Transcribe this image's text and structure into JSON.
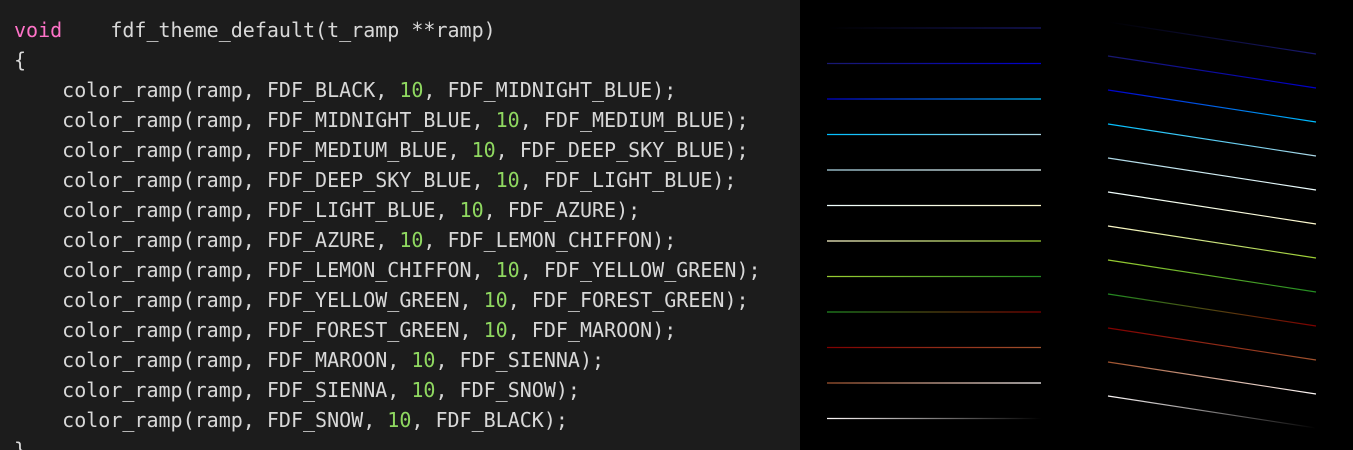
{
  "editor": {
    "signature": {
      "keyword": "void",
      "rest": "    fdf_theme_default(t_ramp **ramp)"
    },
    "open_brace": "{",
    "close_brace": "}",
    "calls": [
      {
        "prefix": "    color_ramp(ramp, FDF_BLACK, ",
        "num": "10",
        "suffix": ", FDF_MIDNIGHT_BLUE);"
      },
      {
        "prefix": "    color_ramp(ramp, FDF_MIDNIGHT_BLUE, ",
        "num": "10",
        "suffix": ", FDF_MEDIUM_BLUE);"
      },
      {
        "prefix": "    color_ramp(ramp, FDF_MEDIUM_BLUE, ",
        "num": "10",
        "suffix": ", FDF_DEEP_SKY_BLUE);"
      },
      {
        "prefix": "    color_ramp(ramp, FDF_DEEP_SKY_BLUE, ",
        "num": "10",
        "suffix": ", FDF_LIGHT_BLUE);"
      },
      {
        "prefix": "    color_ramp(ramp, FDF_LIGHT_BLUE, ",
        "num": "10",
        "suffix": ", FDF_AZURE);"
      },
      {
        "prefix": "    color_ramp(ramp, FDF_AZURE, ",
        "num": "10",
        "suffix": ", FDF_LEMON_CHIFFON);"
      },
      {
        "prefix": "    color_ramp(ramp, FDF_LEMON_CHIFFON, ",
        "num": "10",
        "suffix": ", FDF_YELLOW_GREEN);"
      },
      {
        "prefix": "    color_ramp(ramp, FDF_YELLOW_GREEN, ",
        "num": "10",
        "suffix": ", FDF_FOREST_GREEN);"
      },
      {
        "prefix": "    color_ramp(ramp, FDF_FOREST_GREEN, ",
        "num": "10",
        "suffix": ", FDF_MAROON);"
      },
      {
        "prefix": "    color_ramp(ramp, FDF_MAROON, ",
        "num": "10",
        "suffix": ", FDF_SIENNA);"
      },
      {
        "prefix": "    color_ramp(ramp, FDF_SIENNA, ",
        "num": "10",
        "suffix": ", FDF_SNOW);"
      },
      {
        "prefix": "    color_ramp(ramp, FDF_SNOW, ",
        "num": "10",
        "suffix": ", FDF_BLACK);"
      }
    ]
  },
  "colors": {
    "editor_bg": "#1c1c1c",
    "keyword": "#ff73c8",
    "number": "#8fd860",
    "text": "#d8d8d8",
    "preview_bg": "#000000"
  },
  "preview": {
    "ramp_colors": [
      [
        "#000000",
        "#191970"
      ],
      [
        "#191970",
        "#0000cd"
      ],
      [
        "#0000cd",
        "#00bfff"
      ],
      [
        "#00bfff",
        "#add8e6"
      ],
      [
        "#add8e6",
        "#f0ffff"
      ],
      [
        "#f0ffff",
        "#fffacd"
      ],
      [
        "#fffacd",
        "#9acd32"
      ],
      [
        "#9acd32",
        "#228b22"
      ],
      [
        "#228b22",
        "#800000"
      ],
      [
        "#800000",
        "#a0522d"
      ],
      [
        "#a0522d",
        "#fffafa"
      ],
      [
        "#fffafa",
        "#000000"
      ]
    ]
  }
}
